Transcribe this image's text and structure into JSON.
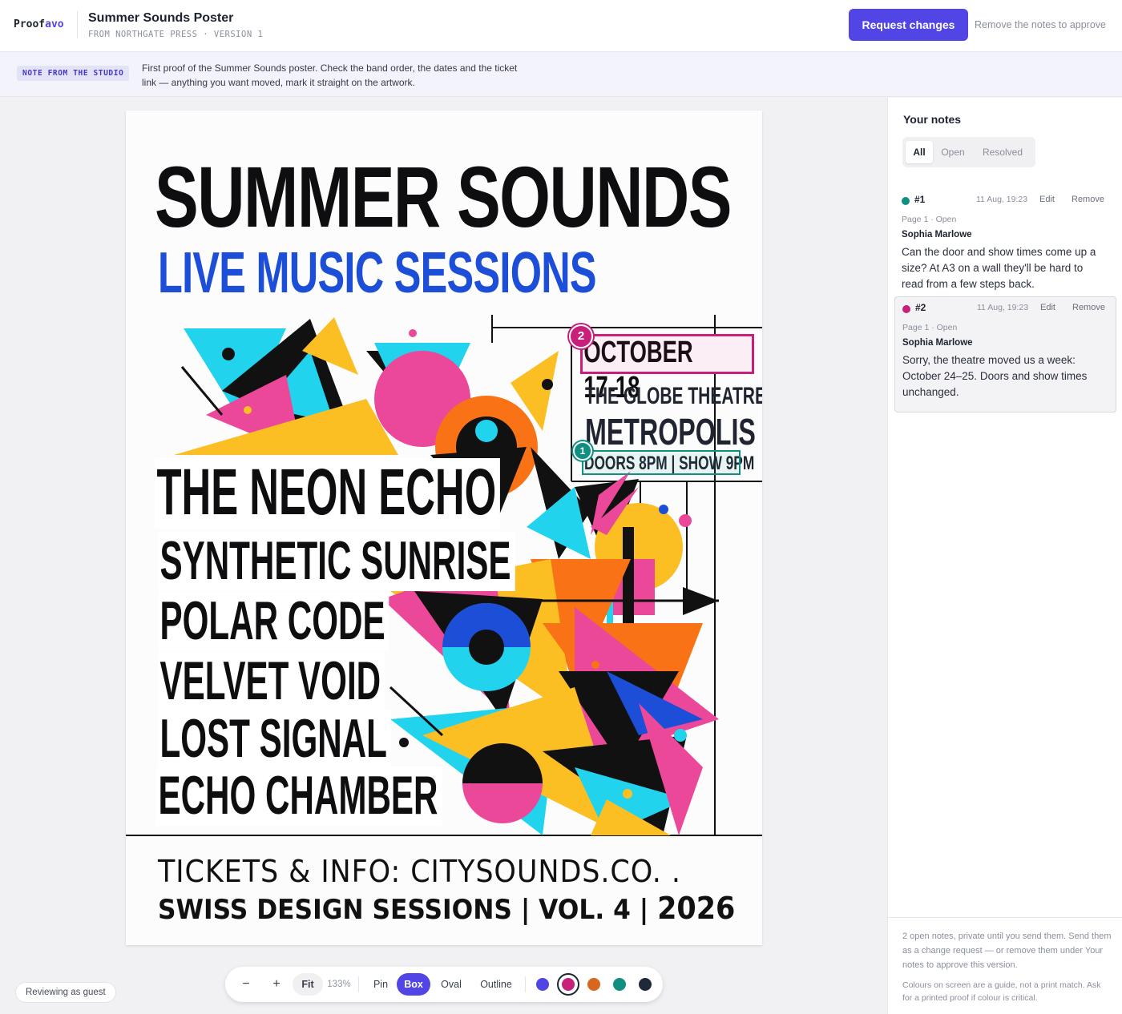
{
  "header": {
    "brand_prefix": "Proof",
    "brand_suffix": "avo",
    "title": "Summer Sounds Poster",
    "meta": "FROM NORTHGATE PRESS · VERSION 1",
    "request_button": "Request changes",
    "approve_hint": "Remove the notes to approve"
  },
  "studio_note": {
    "tag": "NOTE FROM THE STUDIO",
    "text": "First proof of the Summer Sounds poster. Check the band order, the dates and the ticket link — anything you want moved, mark it straight on the artwork."
  },
  "poster": {
    "title": "SUMMER SOUNDS",
    "subtitle": "LIVE MUSIC SESSIONS",
    "bands": [
      "THE NEON ECHO",
      "SYNTHETIC SUNRISE",
      "POLAR CODE",
      "VELVET VOID",
      "LOST SIGNAL",
      "ECHO CHAMBER"
    ],
    "date": "OCTOBER 17-18",
    "venue": "THE GLOBE THEATRE",
    "city": "METROPOLIS",
    "times": "DOORS 8PM | SHOW 9PM",
    "tickets": "TICKETS & INFO:  CITYSOUNDS.CO. .",
    "series": "SWISS DESIGN SESSIONS | VOL. 4 | ",
    "year": "2026",
    "annotations": [
      {
        "number": "2",
        "color": "#c8207a"
      },
      {
        "number": "1",
        "color": "#0f8f80"
      }
    ]
  },
  "guest_badge": "Reviewing as guest",
  "toolbar": {
    "zoom_out": "−",
    "zoom_in": "+",
    "fit": "Fit",
    "zoom_level": "133%",
    "tools": [
      "Pin",
      "Box",
      "Oval",
      "Outline"
    ],
    "active_tool": "Box",
    "colors": [
      "#4f46e5",
      "#c8207a",
      "#d9661f",
      "#0f8f80",
      "#1f2937"
    ],
    "selected_color": "#c8207a"
  },
  "sidebar": {
    "title": "Your notes",
    "filters": [
      "All",
      "Open",
      "Resolved"
    ],
    "active_filter": "All",
    "notes": [
      {
        "number": "#1",
        "color": "#0f8f80",
        "time": "11 Aug, 19:23",
        "edit": "Edit",
        "remove": "Remove",
        "status": "Page 1 · Open",
        "author": "Sophia Marlowe",
        "body": "Can the door and show times come up a size? At A3 on a wall they'll be hard to    read from a few steps back."
      },
      {
        "number": "#2",
        "color": "#c8207a",
        "time": "11 Aug, 19:23",
        "edit": "Edit",
        "remove": "Remove",
        "status": "Page 1 · Open",
        "author": "Sophia Marlowe",
        "body": "Sorry, the theatre moved us a week: October 24–25. Doors and show times unchanged."
      }
    ],
    "footer_1": "2 open notes, private until you send them. Send them as a change request — or remove them under Your notes to approve this version.",
    "footer_2": "Colours on screen are a guide, not a print match. Ask for a printed proof if colour is critical."
  }
}
